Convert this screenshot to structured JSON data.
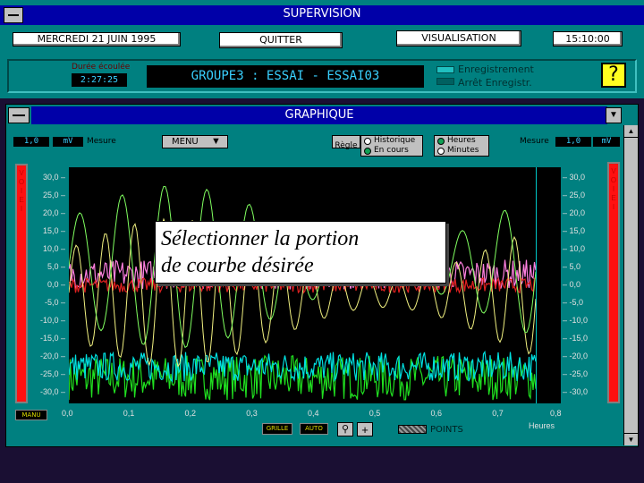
{
  "supervision": {
    "title": "SUPERVISION",
    "date": "MERCREDI  21 JUIN 1995",
    "quit_label": "QUITTER",
    "view_label": "VISUALISATION",
    "time": "15:10:00",
    "elapsed_label": "Durée écoulée",
    "elapsed_value": "2:27:25",
    "group_title": "GROUPE3 : ESSAI - ESSAI03",
    "legend_record": "Enregistrement",
    "legend_stop": "Arrêt Enregistr.",
    "help_symbol": "?"
  },
  "graph": {
    "title": "GRAPHIQUE",
    "left_scale_value": "1,0",
    "left_scale_unit": "mV",
    "left_measure": "Mesure",
    "menu_label": "MENU",
    "ruler_label": "Règle",
    "mode_history": "Historique",
    "mode_live": "En cours",
    "time_hours": "Heures",
    "time_minutes": "Minutes",
    "right_measure": "Mesure",
    "right_scale_value": "1,0",
    "right_scale_unit": "mV",
    "left_bar_letters": [
      "V",
      "O",
      "I",
      "E",
      "I"
    ],
    "right_bar_letters": [
      "V",
      "O",
      "I",
      "E",
      "I"
    ],
    "manu_label": "MANU",
    "grid_label": "GRILLE",
    "auto_label": "AUTO",
    "plus_symbol": "+",
    "points_label": "POINTS",
    "xaxis_unit": "Heures",
    "overlay_line1": "Sélectionner la portion",
    "overlay_line2": "de courbe désirée",
    "colors": {
      "win_bg": "#008080",
      "title_bg": "#0000a8",
      "lcd_text": "#39d0ff",
      "plot_bg": "#000000",
      "cursor": "#00c8c8"
    }
  },
  "chart_data": {
    "type": "line",
    "y_ticks_left": [
      "30,0",
      "25,0",
      "20,0",
      "15,0",
      "10,0",
      "5,0",
      "0,0",
      "-5,0",
      "-10,0",
      "-15,0",
      "-20,0",
      "-25,0",
      "-30,0"
    ],
    "y_ticks_right": [
      "30,0",
      "25,0",
      "20,0",
      "15,0",
      "10,0",
      "5,0",
      "0,0",
      "-5,0",
      "-10,0",
      "-15,0",
      "-20,0",
      "-25,0",
      "-30,0"
    ],
    "x_ticks": [
      "0,0",
      "0,1",
      "0,2",
      "0,3",
      "0,4",
      "0,5",
      "0,6",
      "0,7",
      "0,8"
    ],
    "ylim": [
      -30,
      30
    ],
    "xlim": [
      0,
      0.8
    ],
    "cursor_x": 0.76,
    "grid": false,
    "series": [
      {
        "color": "#20e020",
        "style": "noise-band",
        "center": -25,
        "amp": 6,
        "x0": 0,
        "x1": 0.76
      },
      {
        "color": "#00e0e0",
        "style": "noise-band",
        "center": -22,
        "amp": 4,
        "x0": 0,
        "x1": 0.76
      },
      {
        "color": "#ff80e0",
        "style": "noise-band",
        "center": 3,
        "amp": 4,
        "x0": 0,
        "x1": 0.76
      },
      {
        "color": "#e02020",
        "style": "noise-band",
        "center": 0,
        "amp": 2,
        "x0": 0,
        "x1": 0.76
      },
      {
        "color": "#f0f080",
        "style": "sine",
        "center": -2,
        "amp": 20,
        "periods": 16,
        "x0": 0,
        "x1": 0.76
      },
      {
        "color": "#80ff60",
        "style": "sine",
        "center": 5,
        "amp": 22,
        "periods": 11,
        "x0": 0,
        "x1": 0.76
      }
    ]
  }
}
